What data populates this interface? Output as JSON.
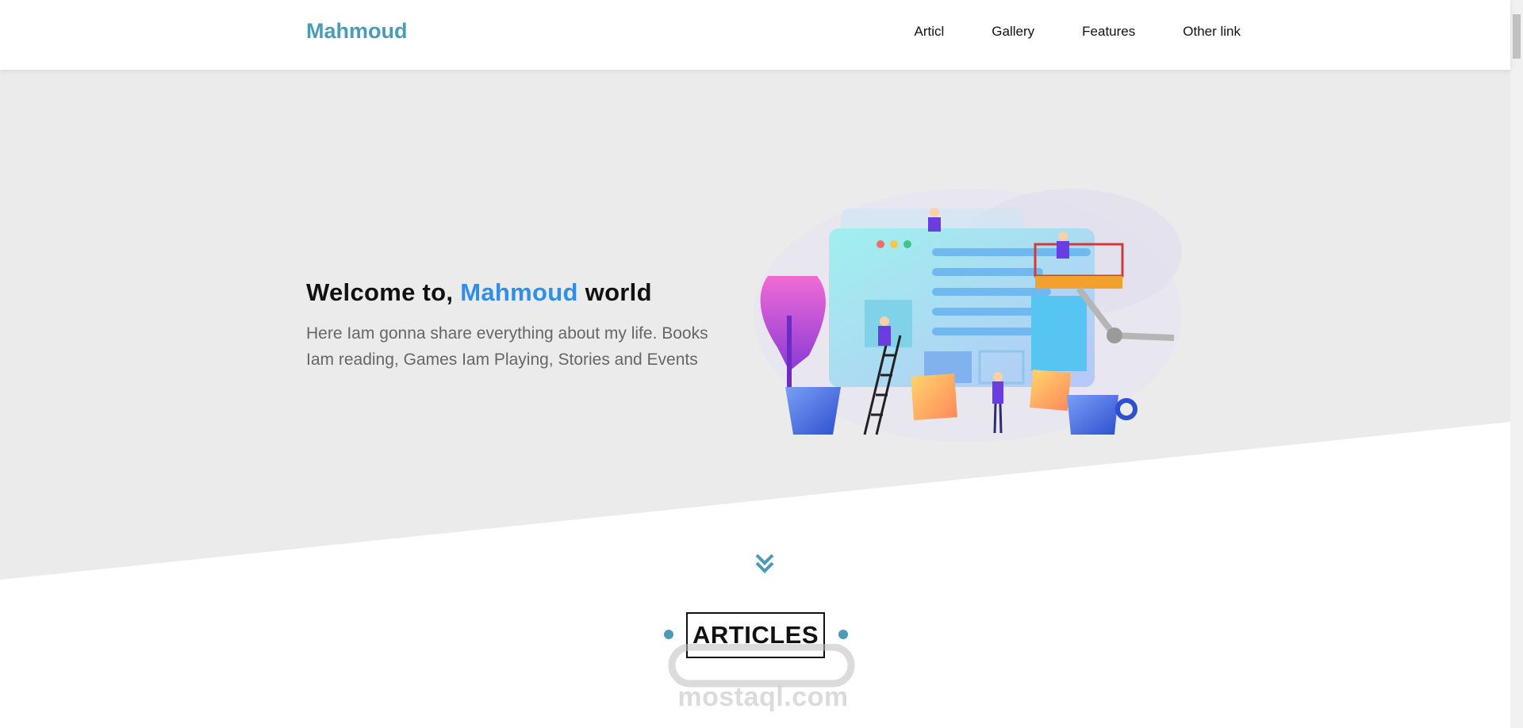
{
  "header": {
    "logo": "Mahmoud",
    "nav": [
      "Articl",
      "Gallery",
      "Features",
      "Other link"
    ]
  },
  "hero": {
    "title_prefix": "Welcome to,",
    "title_accent": "Mahmoud",
    "title_suffix": "world",
    "text": "Here Iam gonna share everything about my life. Books Iam reading, Games Iam Playing, Stories and Events"
  },
  "articles": {
    "title": "ARTICLES"
  },
  "watermark": {
    "text": "mostaql.com"
  },
  "colors": {
    "brand": "#4c9bb6",
    "accent": "#2f8fe8",
    "hero_bg": "#ebebeb"
  },
  "icons": {
    "scroll": "double-chevron-down-icon"
  }
}
